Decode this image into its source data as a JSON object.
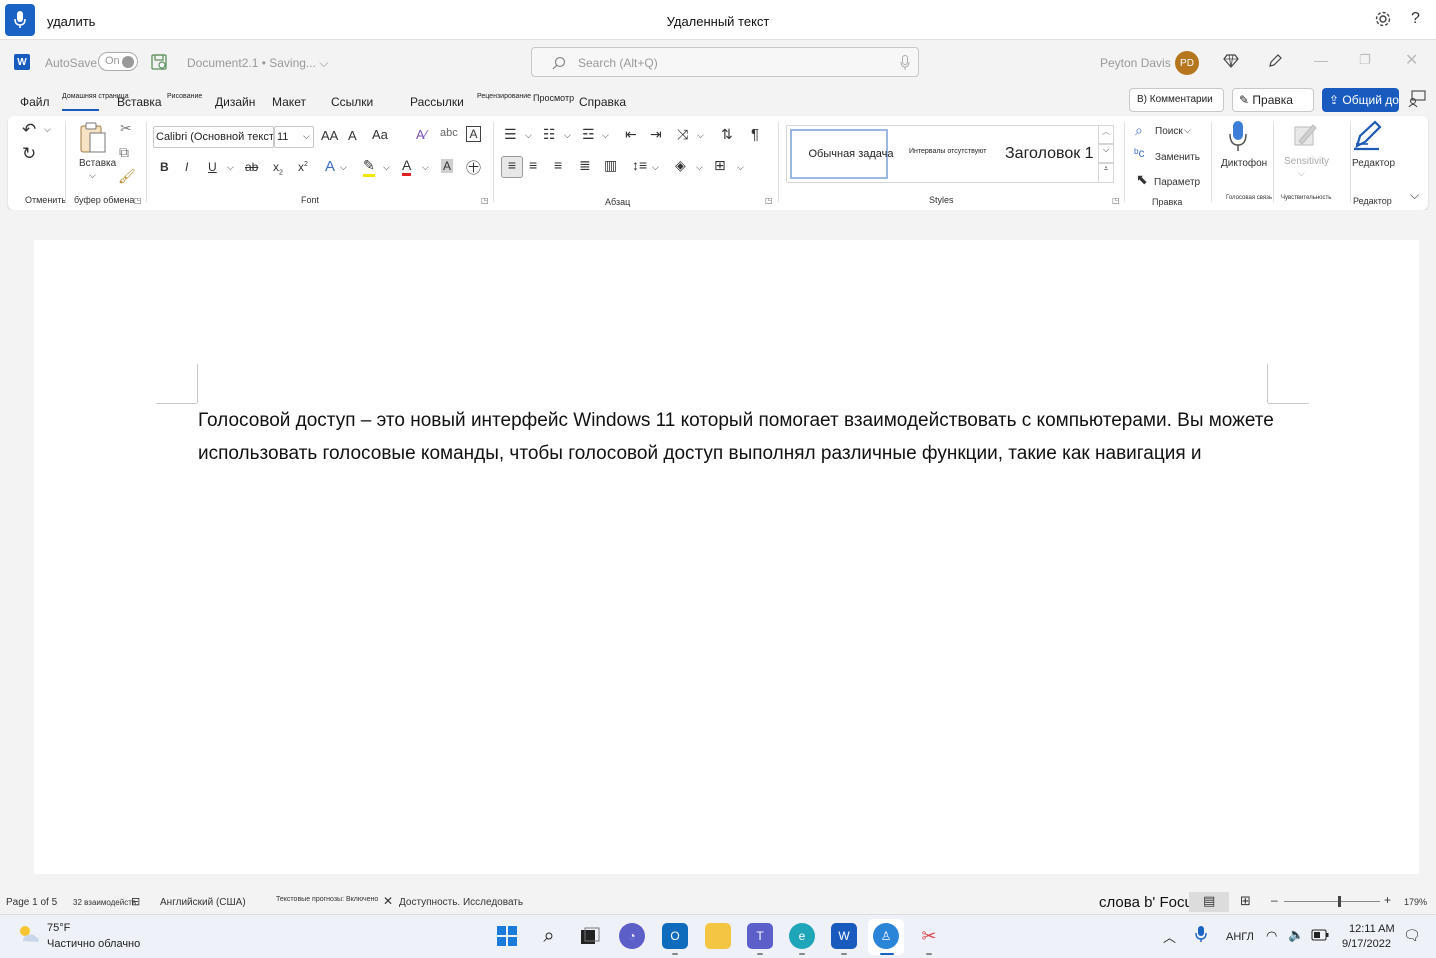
{
  "voice_bar": {
    "command": "удалить",
    "status": "Удаленный текст"
  },
  "titlebar": {
    "autosave_label": "AutoSave",
    "autosave_state": "On",
    "doc_name": "Document2.1 • Saving... ⌵",
    "search_placeholder": "Search (Alt+Q)",
    "user_name": "Peyton Davis",
    "user_initials": "PD",
    "word_logo": "W"
  },
  "tabs": {
    "file": "Файл",
    "home": "Домашняя страница",
    "insert": "Вставка",
    "draw": "Рисование",
    "design": "Дизайн",
    "layout": "Макет",
    "references": "Ссылки",
    "mailings": "Рассылки",
    "review": "Рецензирование",
    "view": "Просмотр",
    "help": "Справка",
    "comments_btn": "В) Комментарии",
    "editing_btn": "Правка",
    "share_btn": "Общий до"
  },
  "ribbon": {
    "undo_label": "Отменить",
    "paste_label": "Вставка",
    "clipboard_label": "буфер обмена",
    "font_name": "Calibri (Основной текст)",
    "font_size": "11",
    "font_label": "Font",
    "paragraph_label": "Абзац",
    "styles_label": "Styles",
    "style_normal": "Обычная задача",
    "style_nospacing": "Интервалы отсутствуют",
    "style_heading1": "Заголовок 1",
    "find_label": "Поиск",
    "replace_label": "Заменить",
    "select_label": "Параметр",
    "editing_label": "Правка",
    "dictate_label": "Диктофон",
    "voice_label": "Голосовая связь",
    "sensitivity_label": "Sensitivity",
    "sensitivity_group": "Чувствительность",
    "editor_label": "Редактор",
    "editor_group": "Редактор",
    "grow_font": "AA",
    "shrink_font": "A",
    "change_case": "Aa",
    "bold": "B",
    "italic": "I",
    "underline": "U",
    "strike": "ab",
    "subscript": "x",
    "superscript": "x",
    "pilcrow": "¶"
  },
  "document": {
    "text": "Голосовой доступ – это новый интерфейс Windows 11 который помогает взаимодействовать с компьютерами. Вы можете использовать голосовые команды, чтобы голосовой доступ выполнял различные функции, такие как навигация и"
  },
  "statusbar": {
    "page": "Page 1 of 5",
    "words": "32 взаимодейств.",
    "language": "Английский (США)",
    "predictions": "Текстовые прогнозы: Включено",
    "accessibility": "Доступность. Исследовать",
    "focus": "слова b' Focus",
    "zoom": "179%"
  },
  "taskbar": {
    "weather_temp": "75°F",
    "weather_desc": "Частично облачно",
    "lang": "АНГЛ",
    "time": "12:11 AM",
    "date": "9/17/2022"
  },
  "colors": {
    "accent": "#185abd",
    "voice_mic": "#1a63c4"
  }
}
